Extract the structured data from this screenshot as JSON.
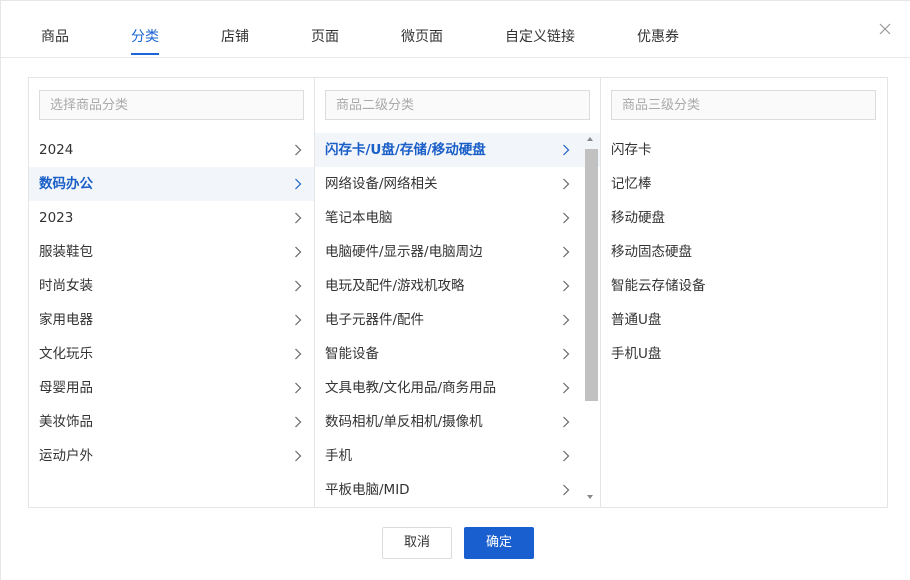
{
  "tabs": [
    {
      "label": "商品"
    },
    {
      "label": "分类"
    },
    {
      "label": "店铺"
    },
    {
      "label": "页面"
    },
    {
      "label": "微页面"
    },
    {
      "label": "自定义链接"
    },
    {
      "label": "优惠券"
    }
  ],
  "active_tab": "分类",
  "panel1": {
    "placeholder": "选择商品分类",
    "items": [
      {
        "label": "2024"
      },
      {
        "label": "数码办公"
      },
      {
        "label": "2023"
      },
      {
        "label": "服装鞋包"
      },
      {
        "label": "时尚女装"
      },
      {
        "label": "家用电器"
      },
      {
        "label": "文化玩乐"
      },
      {
        "label": "母婴用品"
      },
      {
        "label": "美妆饰品"
      },
      {
        "label": "运动户外"
      }
    ],
    "selected": "数码办公"
  },
  "panel2": {
    "placeholder": "商品二级分类",
    "items": [
      {
        "label": "闪存卡/U盘/存储/移动硬盘"
      },
      {
        "label": "网络设备/网络相关"
      },
      {
        "label": "笔记本电脑"
      },
      {
        "label": "电脑硬件/显示器/电脑周边"
      },
      {
        "label": "电玩及配件/游戏机攻略"
      },
      {
        "label": "电子元器件/配件"
      },
      {
        "label": "智能设备"
      },
      {
        "label": "文具电教/文化用品/商务用品"
      },
      {
        "label": "数码相机/单反相机/摄像机"
      },
      {
        "label": "手机"
      },
      {
        "label": "平板电脑/MID"
      }
    ],
    "selected": "闪存卡/U盘/存储/移动硬盘"
  },
  "panel3": {
    "placeholder": "商品三级分类",
    "items": [
      {
        "label": "闪存卡"
      },
      {
        "label": "记忆棒"
      },
      {
        "label": "移动硬盘"
      },
      {
        "label": "移动固态硬盘"
      },
      {
        "label": "智能云存储设备"
      },
      {
        "label": "普通U盘"
      },
      {
        "label": "手机U盘"
      }
    ]
  },
  "footer": {
    "cancel_label": "取消",
    "ok_label": "确定"
  },
  "colors": {
    "accent": "#1a5fd0",
    "selected_bg": "#f2f5fa"
  },
  "icons": {
    "close": "close-icon",
    "chevron": "chevron-right-icon"
  }
}
